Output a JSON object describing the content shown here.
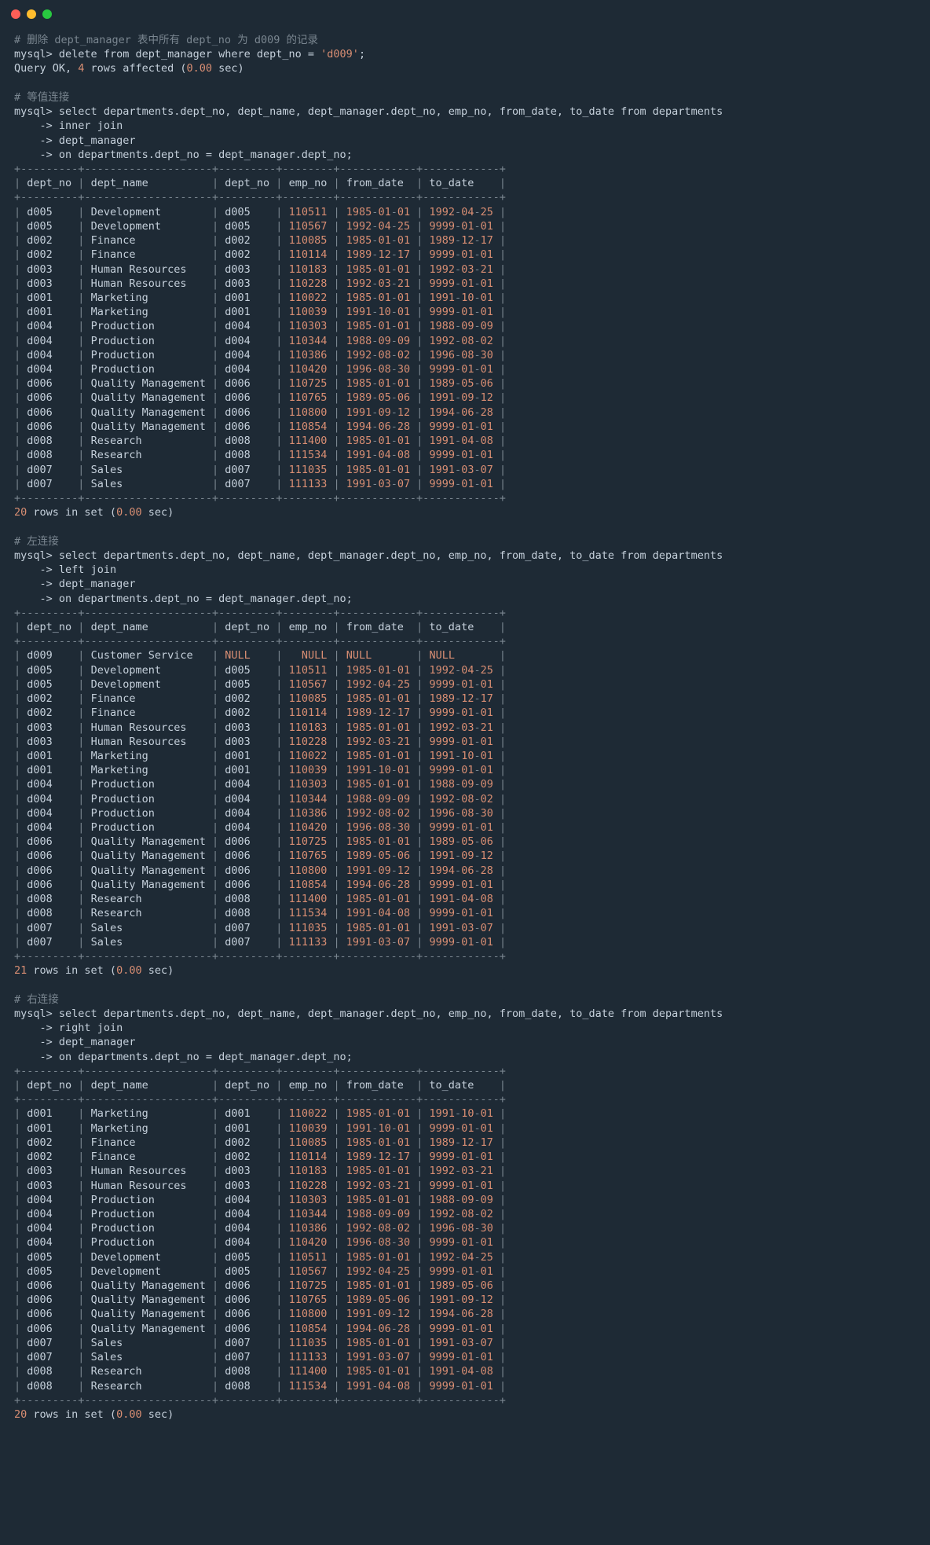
{
  "titlebar": {
    "buttons": [
      "close",
      "minimize",
      "zoom"
    ]
  },
  "block1": {
    "comment": "# 删除 dept_manager 表中所有 dept_no 为 d009 的记录",
    "prompt": "mysql>",
    "sql": "delete from dept_manager where dept_no = ",
    "str": "'d009'",
    "tail": ";",
    "result_pre": "Query OK, ",
    "affected": "4",
    "result_mid": " rows affected (",
    "time": "0.00",
    "result_post": " sec)"
  },
  "block2": {
    "comment": "# 等值连接",
    "prompt": "mysql>",
    "line1": "select departments.dept_no, dept_name, dept_manager.dept_no, emp_no, from_date, to_date from departments",
    "cont": "    ->",
    "line2": "inner join",
    "line3": "dept_manager",
    "line4": "on departments.dept_no = dept_manager.dept_no;",
    "headers": [
      "dept_no",
      "dept_name",
      "dept_no",
      "emp_no",
      "from_date",
      "to_date"
    ],
    "sep": "+---------+--------------------+---------+--------+------------+------------+",
    "rows": [
      [
        "d005",
        "Development",
        "d005",
        "110511",
        "1985-01-01",
        "1992-04-25"
      ],
      [
        "d005",
        "Development",
        "d005",
        "110567",
        "1992-04-25",
        "9999-01-01"
      ],
      [
        "d002",
        "Finance",
        "d002",
        "110085",
        "1985-01-01",
        "1989-12-17"
      ],
      [
        "d002",
        "Finance",
        "d002",
        "110114",
        "1989-12-17",
        "9999-01-01"
      ],
      [
        "d003",
        "Human Resources",
        "d003",
        "110183",
        "1985-01-01",
        "1992-03-21"
      ],
      [
        "d003",
        "Human Resources",
        "d003",
        "110228",
        "1992-03-21",
        "9999-01-01"
      ],
      [
        "d001",
        "Marketing",
        "d001",
        "110022",
        "1985-01-01",
        "1991-10-01"
      ],
      [
        "d001",
        "Marketing",
        "d001",
        "110039",
        "1991-10-01",
        "9999-01-01"
      ],
      [
        "d004",
        "Production",
        "d004",
        "110303",
        "1985-01-01",
        "1988-09-09"
      ],
      [
        "d004",
        "Production",
        "d004",
        "110344",
        "1988-09-09",
        "1992-08-02"
      ],
      [
        "d004",
        "Production",
        "d004",
        "110386",
        "1992-08-02",
        "1996-08-30"
      ],
      [
        "d004",
        "Production",
        "d004",
        "110420",
        "1996-08-30",
        "9999-01-01"
      ],
      [
        "d006",
        "Quality Management",
        "d006",
        "110725",
        "1985-01-01",
        "1989-05-06"
      ],
      [
        "d006",
        "Quality Management",
        "d006",
        "110765",
        "1989-05-06",
        "1991-09-12"
      ],
      [
        "d006",
        "Quality Management",
        "d006",
        "110800",
        "1991-09-12",
        "1994-06-28"
      ],
      [
        "d006",
        "Quality Management",
        "d006",
        "110854",
        "1994-06-28",
        "9999-01-01"
      ],
      [
        "d008",
        "Research",
        "d008",
        "111400",
        "1985-01-01",
        "1991-04-08"
      ],
      [
        "d008",
        "Research",
        "d008",
        "111534",
        "1991-04-08",
        "9999-01-01"
      ],
      [
        "d007",
        "Sales",
        "d007",
        "111035",
        "1985-01-01",
        "1991-03-07"
      ],
      [
        "d007",
        "Sales",
        "d007",
        "111133",
        "1991-03-07",
        "9999-01-01"
      ]
    ],
    "count_n": "20",
    "count_mid": " rows in set (",
    "count_time": "0.00",
    "count_post": " sec)"
  },
  "block3": {
    "comment": "# 左连接",
    "prompt": "mysql>",
    "line1": "select departments.dept_no, dept_name, dept_manager.dept_no, emp_no, from_date, to_date from departments",
    "cont": "    ->",
    "line2": "left join",
    "line3": "dept_manager",
    "line4": "on departments.dept_no = dept_manager.dept_no;",
    "headers": [
      "dept_no",
      "dept_name",
      "dept_no",
      "emp_no",
      "from_date",
      "to_date"
    ],
    "sep": "+---------+--------------------+---------+--------+------------+------------+",
    "rows": [
      [
        "d009",
        "Customer Service",
        "NULL",
        "NULL",
        "NULL",
        "NULL"
      ],
      [
        "d005",
        "Development",
        "d005",
        "110511",
        "1985-01-01",
        "1992-04-25"
      ],
      [
        "d005",
        "Development",
        "d005",
        "110567",
        "1992-04-25",
        "9999-01-01"
      ],
      [
        "d002",
        "Finance",
        "d002",
        "110085",
        "1985-01-01",
        "1989-12-17"
      ],
      [
        "d002",
        "Finance",
        "d002",
        "110114",
        "1989-12-17",
        "9999-01-01"
      ],
      [
        "d003",
        "Human Resources",
        "d003",
        "110183",
        "1985-01-01",
        "1992-03-21"
      ],
      [
        "d003",
        "Human Resources",
        "d003",
        "110228",
        "1992-03-21",
        "9999-01-01"
      ],
      [
        "d001",
        "Marketing",
        "d001",
        "110022",
        "1985-01-01",
        "1991-10-01"
      ],
      [
        "d001",
        "Marketing",
        "d001",
        "110039",
        "1991-10-01",
        "9999-01-01"
      ],
      [
        "d004",
        "Production",
        "d004",
        "110303",
        "1985-01-01",
        "1988-09-09"
      ],
      [
        "d004",
        "Production",
        "d004",
        "110344",
        "1988-09-09",
        "1992-08-02"
      ],
      [
        "d004",
        "Production",
        "d004",
        "110386",
        "1992-08-02",
        "1996-08-30"
      ],
      [
        "d004",
        "Production",
        "d004",
        "110420",
        "1996-08-30",
        "9999-01-01"
      ],
      [
        "d006",
        "Quality Management",
        "d006",
        "110725",
        "1985-01-01",
        "1989-05-06"
      ],
      [
        "d006",
        "Quality Management",
        "d006",
        "110765",
        "1989-05-06",
        "1991-09-12"
      ],
      [
        "d006",
        "Quality Management",
        "d006",
        "110800",
        "1991-09-12",
        "1994-06-28"
      ],
      [
        "d006",
        "Quality Management",
        "d006",
        "110854",
        "1994-06-28",
        "9999-01-01"
      ],
      [
        "d008",
        "Research",
        "d008",
        "111400",
        "1985-01-01",
        "1991-04-08"
      ],
      [
        "d008",
        "Research",
        "d008",
        "111534",
        "1991-04-08",
        "9999-01-01"
      ],
      [
        "d007",
        "Sales",
        "d007",
        "111035",
        "1985-01-01",
        "1991-03-07"
      ],
      [
        "d007",
        "Sales",
        "d007",
        "111133",
        "1991-03-07",
        "9999-01-01"
      ]
    ],
    "count_n": "21",
    "count_mid": " rows in set (",
    "count_time": "0.00",
    "count_post": " sec)"
  },
  "block4": {
    "comment": "# 右连接",
    "prompt": "mysql>",
    "line1": "select departments.dept_no, dept_name, dept_manager.dept_no, emp_no, from_date, to_date from departments",
    "cont": "    ->",
    "line2": "right join",
    "line3": "dept_manager",
    "line4": "on departments.dept_no = dept_manager.dept_no;",
    "headers": [
      "dept_no",
      "dept_name",
      "dept_no",
      "emp_no",
      "from_date",
      "to_date"
    ],
    "sep": "+---------+--------------------+---------+--------+------------+------------+",
    "rows": [
      [
        "d001",
        "Marketing",
        "d001",
        "110022",
        "1985-01-01",
        "1991-10-01"
      ],
      [
        "d001",
        "Marketing",
        "d001",
        "110039",
        "1991-10-01",
        "9999-01-01"
      ],
      [
        "d002",
        "Finance",
        "d002",
        "110085",
        "1985-01-01",
        "1989-12-17"
      ],
      [
        "d002",
        "Finance",
        "d002",
        "110114",
        "1989-12-17",
        "9999-01-01"
      ],
      [
        "d003",
        "Human Resources",
        "d003",
        "110183",
        "1985-01-01",
        "1992-03-21"
      ],
      [
        "d003",
        "Human Resources",
        "d003",
        "110228",
        "1992-03-21",
        "9999-01-01"
      ],
      [
        "d004",
        "Production",
        "d004",
        "110303",
        "1985-01-01",
        "1988-09-09"
      ],
      [
        "d004",
        "Production",
        "d004",
        "110344",
        "1988-09-09",
        "1992-08-02"
      ],
      [
        "d004",
        "Production",
        "d004",
        "110386",
        "1992-08-02",
        "1996-08-30"
      ],
      [
        "d004",
        "Production",
        "d004",
        "110420",
        "1996-08-30",
        "9999-01-01"
      ],
      [
        "d005",
        "Development",
        "d005",
        "110511",
        "1985-01-01",
        "1992-04-25"
      ],
      [
        "d005",
        "Development",
        "d005",
        "110567",
        "1992-04-25",
        "9999-01-01"
      ],
      [
        "d006",
        "Quality Management",
        "d006",
        "110725",
        "1985-01-01",
        "1989-05-06"
      ],
      [
        "d006",
        "Quality Management",
        "d006",
        "110765",
        "1989-05-06",
        "1991-09-12"
      ],
      [
        "d006",
        "Quality Management",
        "d006",
        "110800",
        "1991-09-12",
        "1994-06-28"
      ],
      [
        "d006",
        "Quality Management",
        "d006",
        "110854",
        "1994-06-28",
        "9999-01-01"
      ],
      [
        "d007",
        "Sales",
        "d007",
        "111035",
        "1985-01-01",
        "1991-03-07"
      ],
      [
        "d007",
        "Sales",
        "d007",
        "111133",
        "1991-03-07",
        "9999-01-01"
      ],
      [
        "d008",
        "Research",
        "d008",
        "111400",
        "1985-01-01",
        "1991-04-08"
      ],
      [
        "d008",
        "Research",
        "d008",
        "111534",
        "1991-04-08",
        "9999-01-01"
      ]
    ],
    "count_n": "20",
    "count_mid": " rows in set (",
    "count_time": "0.00",
    "count_post": " sec)"
  },
  "widths": [
    7,
    18,
    7,
    6,
    10,
    10
  ]
}
